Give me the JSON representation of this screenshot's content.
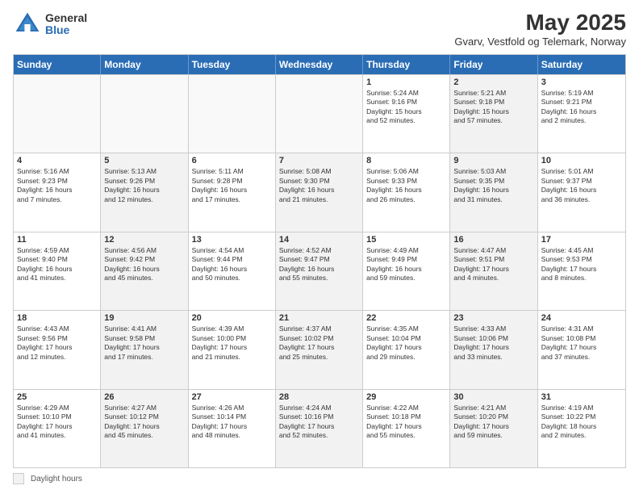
{
  "logo": {
    "general": "General",
    "blue": "Blue"
  },
  "title": "May 2025",
  "location": "Gvarv, Vestfold og Telemark, Norway",
  "days_of_week": [
    "Sunday",
    "Monday",
    "Tuesday",
    "Wednesday",
    "Thursday",
    "Friday",
    "Saturday"
  ],
  "footer": {
    "legend_label": "Daylight hours"
  },
  "rows": [
    [
      {
        "day": "",
        "text": "",
        "empty": true
      },
      {
        "day": "",
        "text": "",
        "empty": true
      },
      {
        "day": "",
        "text": "",
        "empty": true
      },
      {
        "day": "",
        "text": "",
        "empty": true
      },
      {
        "day": "1",
        "text": "Sunrise: 5:24 AM\nSunset: 9:16 PM\nDaylight: 15 hours\nand 52 minutes.",
        "empty": false
      },
      {
        "day": "2",
        "text": "Sunrise: 5:21 AM\nSunset: 9:18 PM\nDaylight: 15 hours\nand 57 minutes.",
        "empty": false,
        "shaded": true
      },
      {
        "day": "3",
        "text": "Sunrise: 5:19 AM\nSunset: 9:21 PM\nDaylight: 16 hours\nand 2 minutes.",
        "empty": false
      }
    ],
    [
      {
        "day": "4",
        "text": "Sunrise: 5:16 AM\nSunset: 9:23 PM\nDaylight: 16 hours\nand 7 minutes.",
        "empty": false
      },
      {
        "day": "5",
        "text": "Sunrise: 5:13 AM\nSunset: 9:26 PM\nDaylight: 16 hours\nand 12 minutes.",
        "empty": false,
        "shaded": true
      },
      {
        "day": "6",
        "text": "Sunrise: 5:11 AM\nSunset: 9:28 PM\nDaylight: 16 hours\nand 17 minutes.",
        "empty": false
      },
      {
        "day": "7",
        "text": "Sunrise: 5:08 AM\nSunset: 9:30 PM\nDaylight: 16 hours\nand 21 minutes.",
        "empty": false,
        "shaded": true
      },
      {
        "day": "8",
        "text": "Sunrise: 5:06 AM\nSunset: 9:33 PM\nDaylight: 16 hours\nand 26 minutes.",
        "empty": false
      },
      {
        "day": "9",
        "text": "Sunrise: 5:03 AM\nSunset: 9:35 PM\nDaylight: 16 hours\nand 31 minutes.",
        "empty": false,
        "shaded": true
      },
      {
        "day": "10",
        "text": "Sunrise: 5:01 AM\nSunset: 9:37 PM\nDaylight: 16 hours\nand 36 minutes.",
        "empty": false
      }
    ],
    [
      {
        "day": "11",
        "text": "Sunrise: 4:59 AM\nSunset: 9:40 PM\nDaylight: 16 hours\nand 41 minutes.",
        "empty": false
      },
      {
        "day": "12",
        "text": "Sunrise: 4:56 AM\nSunset: 9:42 PM\nDaylight: 16 hours\nand 45 minutes.",
        "empty": false,
        "shaded": true
      },
      {
        "day": "13",
        "text": "Sunrise: 4:54 AM\nSunset: 9:44 PM\nDaylight: 16 hours\nand 50 minutes.",
        "empty": false
      },
      {
        "day": "14",
        "text": "Sunrise: 4:52 AM\nSunset: 9:47 PM\nDaylight: 16 hours\nand 55 minutes.",
        "empty": false,
        "shaded": true
      },
      {
        "day": "15",
        "text": "Sunrise: 4:49 AM\nSunset: 9:49 PM\nDaylight: 16 hours\nand 59 minutes.",
        "empty": false
      },
      {
        "day": "16",
        "text": "Sunrise: 4:47 AM\nSunset: 9:51 PM\nDaylight: 17 hours\nand 4 minutes.",
        "empty": false,
        "shaded": true
      },
      {
        "day": "17",
        "text": "Sunrise: 4:45 AM\nSunset: 9:53 PM\nDaylight: 17 hours\nand 8 minutes.",
        "empty": false
      }
    ],
    [
      {
        "day": "18",
        "text": "Sunrise: 4:43 AM\nSunset: 9:56 PM\nDaylight: 17 hours\nand 12 minutes.",
        "empty": false
      },
      {
        "day": "19",
        "text": "Sunrise: 4:41 AM\nSunset: 9:58 PM\nDaylight: 17 hours\nand 17 minutes.",
        "empty": false,
        "shaded": true
      },
      {
        "day": "20",
        "text": "Sunrise: 4:39 AM\nSunset: 10:00 PM\nDaylight: 17 hours\nand 21 minutes.",
        "empty": false
      },
      {
        "day": "21",
        "text": "Sunrise: 4:37 AM\nSunset: 10:02 PM\nDaylight: 17 hours\nand 25 minutes.",
        "empty": false,
        "shaded": true
      },
      {
        "day": "22",
        "text": "Sunrise: 4:35 AM\nSunset: 10:04 PM\nDaylight: 17 hours\nand 29 minutes.",
        "empty": false
      },
      {
        "day": "23",
        "text": "Sunrise: 4:33 AM\nSunset: 10:06 PM\nDaylight: 17 hours\nand 33 minutes.",
        "empty": false,
        "shaded": true
      },
      {
        "day": "24",
        "text": "Sunrise: 4:31 AM\nSunset: 10:08 PM\nDaylight: 17 hours\nand 37 minutes.",
        "empty": false
      }
    ],
    [
      {
        "day": "25",
        "text": "Sunrise: 4:29 AM\nSunset: 10:10 PM\nDaylight: 17 hours\nand 41 minutes.",
        "empty": false
      },
      {
        "day": "26",
        "text": "Sunrise: 4:27 AM\nSunset: 10:12 PM\nDaylight: 17 hours\nand 45 minutes.",
        "empty": false,
        "shaded": true
      },
      {
        "day": "27",
        "text": "Sunrise: 4:26 AM\nSunset: 10:14 PM\nDaylight: 17 hours\nand 48 minutes.",
        "empty": false
      },
      {
        "day": "28",
        "text": "Sunrise: 4:24 AM\nSunset: 10:16 PM\nDaylight: 17 hours\nand 52 minutes.",
        "empty": false,
        "shaded": true
      },
      {
        "day": "29",
        "text": "Sunrise: 4:22 AM\nSunset: 10:18 PM\nDaylight: 17 hours\nand 55 minutes.",
        "empty": false
      },
      {
        "day": "30",
        "text": "Sunrise: 4:21 AM\nSunset: 10:20 PM\nDaylight: 17 hours\nand 59 minutes.",
        "empty": false,
        "shaded": true
      },
      {
        "day": "31",
        "text": "Sunrise: 4:19 AM\nSunset: 10:22 PM\nDaylight: 18 hours\nand 2 minutes.",
        "empty": false
      }
    ]
  ]
}
